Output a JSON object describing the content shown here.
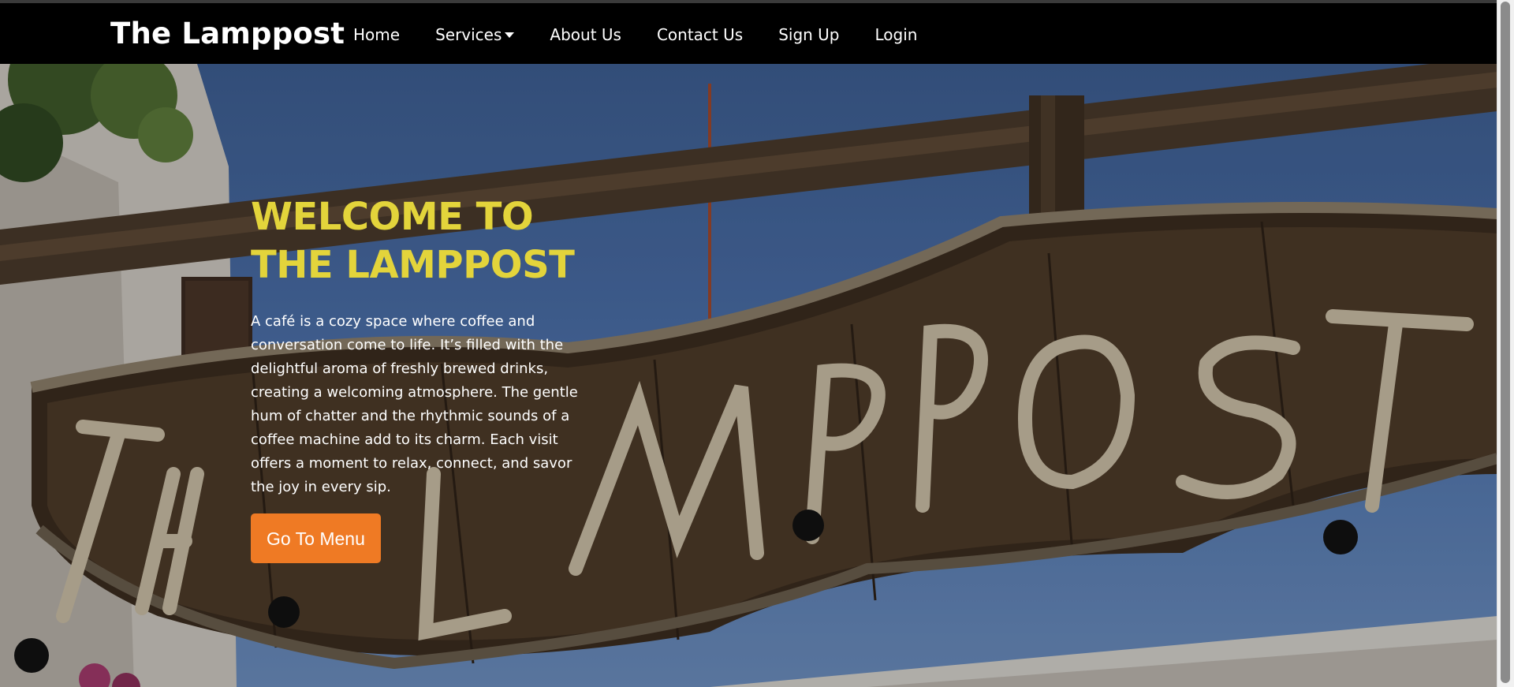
{
  "navbar": {
    "brand": "The Lamppost",
    "links": [
      {
        "label": "Home"
      },
      {
        "label": "Services",
        "has_dropdown": true
      },
      {
        "label": "About Us"
      },
      {
        "label": "Contact Us"
      },
      {
        "label": "Sign Up"
      },
      {
        "label": "Login"
      }
    ]
  },
  "hero": {
    "title": "WELCOME TO THE LAMPPOST",
    "description": "A café is a cozy space where coffee and conversation come to life. It’s filled with the delightful aroma of freshly brewed drinks, creating a welcoming atmosphere. The gentle hum of chatter and the rhythmic sounds of a coffee machine add to its charm. Each visit offers a moment to relax, connect, and savor the joy in every sip.",
    "button_label": "Go To Menu",
    "sign_lettering": "THE LAMPPOST"
  },
  "colors": {
    "navbar_bg": "#000000",
    "title_yellow": "#e3d43b",
    "button_orange": "#ef7a24",
    "sky_blue": "#4a6ea8"
  }
}
